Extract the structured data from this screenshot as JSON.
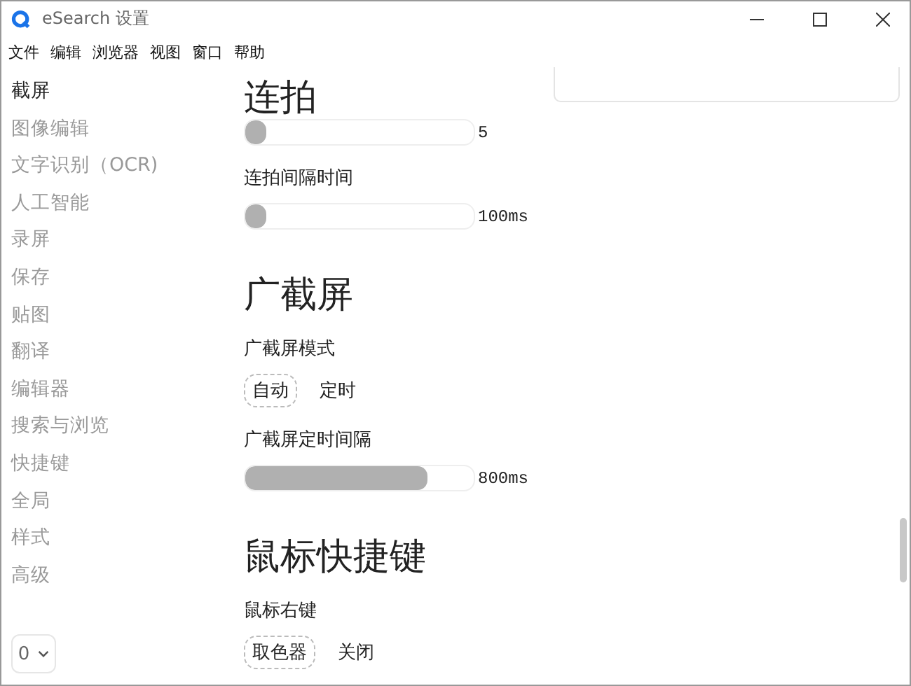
{
  "window": {
    "title": "eSearch 设置"
  },
  "menu": [
    "文件",
    "编辑",
    "浏览器",
    "视图",
    "窗口",
    "帮助"
  ],
  "sidebar": {
    "items": [
      {
        "label": "截屏",
        "selected": true
      },
      {
        "label": "图像编辑",
        "selected": false
      },
      {
        "label": "文字识别（OCR)",
        "selected": false
      },
      {
        "label": "人工智能",
        "selected": false
      },
      {
        "label": "录屏",
        "selected": false
      },
      {
        "label": "保存",
        "selected": false
      },
      {
        "label": "贴图",
        "selected": false
      },
      {
        "label": "翻译",
        "selected": false
      },
      {
        "label": "编辑器",
        "selected": false
      },
      {
        "label": "搜索与浏览",
        "selected": false
      },
      {
        "label": "快捷键",
        "selected": false
      },
      {
        "label": "全局",
        "selected": false
      },
      {
        "label": "样式",
        "selected": false
      },
      {
        "label": "高级",
        "selected": false
      }
    ],
    "select": {
      "value": "0"
    }
  },
  "sections": [
    {
      "title": "连拍",
      "settings": [
        {
          "kind": "slider",
          "level": 0.08,
          "reading": "5"
        },
        {
          "kind": "slider",
          "label": "连拍间隔时间",
          "level": 0.05,
          "reading": "100ms"
        }
      ]
    },
    {
      "title": "广截屏",
      "settings": [
        {
          "kind": "radio",
          "label": "广截屏模式",
          "options": [
            {
              "label": "自动",
              "selected": true
            },
            {
              "label": "定时",
              "selected": false
            }
          ]
        },
        {
          "kind": "slider",
          "label": "广截屏定时间隔",
          "level": 0.8,
          "reading": "800ms"
        }
      ]
    },
    {
      "title": "鼠标快捷键",
      "settings": [
        {
          "kind": "radio",
          "label": "鼠标右键",
          "options": [
            {
              "label": "取色器",
              "selected": true
            },
            {
              "label": "关闭",
              "selected": false
            }
          ]
        }
      ]
    }
  ]
}
